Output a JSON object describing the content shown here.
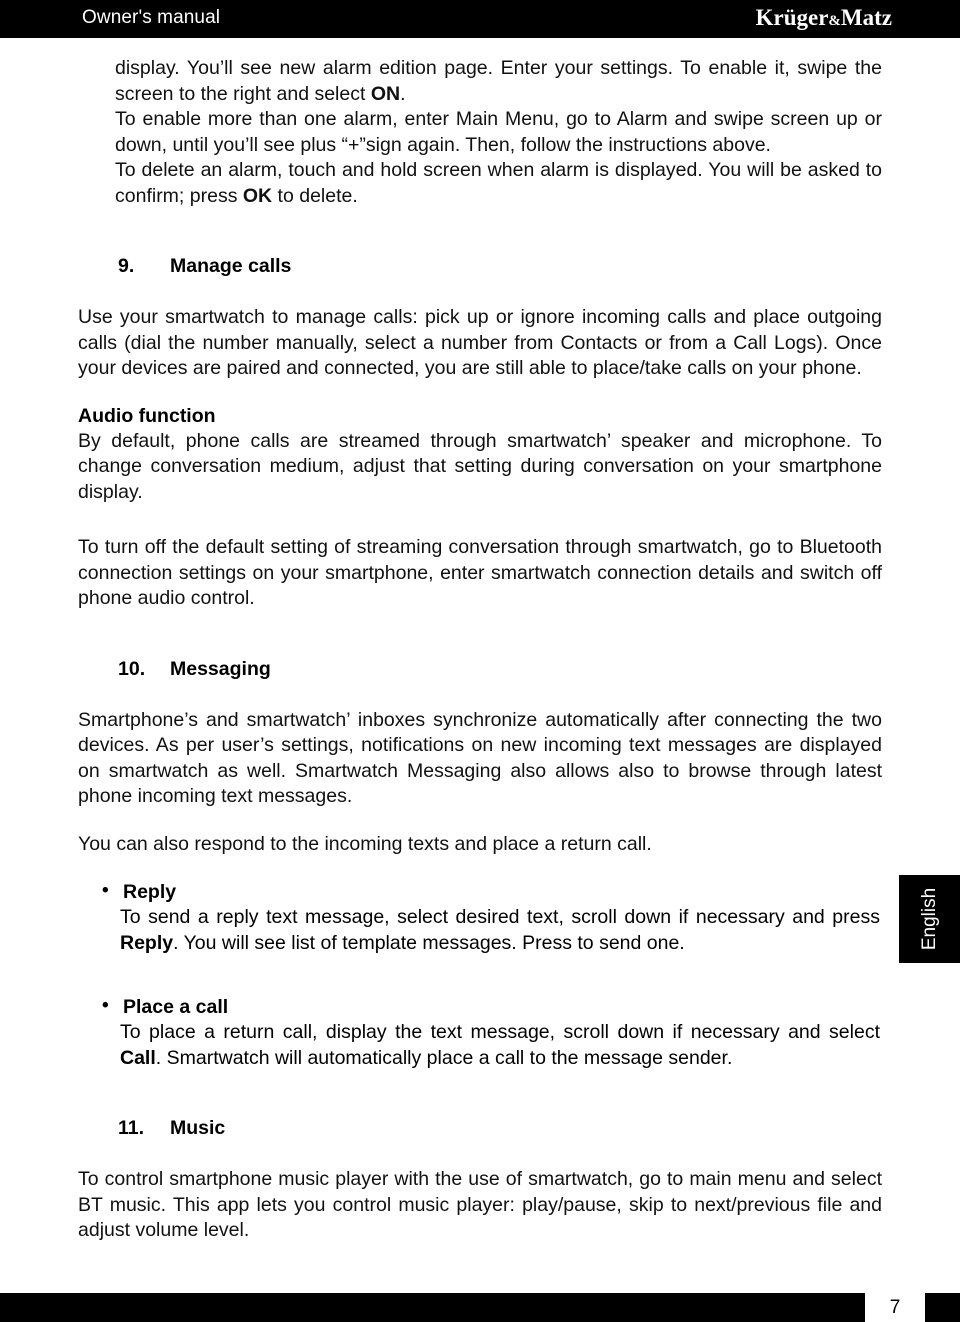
{
  "header": {
    "title": "Owner's manual",
    "logo_part1": "Krüger",
    "logo_amp": "&",
    "logo_part2": "Matz"
  },
  "body": {
    "intro": {
      "p1_a": "display. You’ll see new alarm edition page. Enter your settings. To enable it, swipe the screen to the right and select ",
      "p1_b": "ON",
      "p1_c": ".",
      "p2": "To enable more than one alarm, enter Main Menu, go to Alarm and swipe screen up or down, until you’ll see plus “+”sign again. Then, follow the instructions above.",
      "p3_a": "To delete an alarm, touch and hold screen when alarm is displayed. You will be asked to confirm; press ",
      "p3_b": "OK",
      "p3_c": " to delete."
    },
    "section9": {
      "number": "9.",
      "title": "Manage calls",
      "p1": "Use your smartwatch to manage calls: pick up or ignore incoming calls and place outgoing calls (dial the number manually, select a number from Contacts or from a Call Logs). Once your devices are paired and connected, you are still able to place/take calls on your phone.",
      "subheading": "Audio function",
      "p2": "By default, phone calls are streamed through smartwatch’ speaker and microphone. To change conversation medium, adjust that setting during conversation on your smartphone display.",
      "p3": "To turn off the default setting of streaming conversation through smartwatch, go to Bluetooth connection settings on your smartphone, enter smartwatch connection details and switch off phone audio control."
    },
    "section10": {
      "number": "10.",
      "title": "Messaging",
      "p1": "Smartphone’s and smartwatch’ inboxes synchronize automatically after connecting the two devices. As per user’s settings, notifications on new incoming text messages are displayed on smartwatch as well. Smartwatch Messaging also allows also to browse through latest phone incoming text messages.",
      "p2": "You can also respond to the incoming texts and place a return call.",
      "bullets": [
        {
          "marker": "•",
          "title": "Reply",
          "body_a": "To send a reply text message, select desired text, scroll down if necessary and press ",
          "body_b": "Reply",
          "body_c": ". You will see list of template messages. Press to send one."
        },
        {
          "marker": "•",
          "title": "Place a call",
          "body_a": "To place a return call, display the text message, scroll down if necessary and select ",
          "body_b": "Call",
          "body_c": ". Smartwatch will automatically place a call to the message sender."
        }
      ]
    },
    "section11": {
      "number": "11.",
      "title": "Music",
      "p1": "To control smartphone music player with the use of smartwatch, go to main menu and select BT music. This app lets you control music player: play/pause, skip to next/previous file and adjust volume level."
    }
  },
  "side_tab": {
    "label": "English"
  },
  "footer": {
    "page_number": "7"
  },
  "colors": {
    "bar": "#000000",
    "text": "#111111",
    "page": "#ffffff"
  }
}
